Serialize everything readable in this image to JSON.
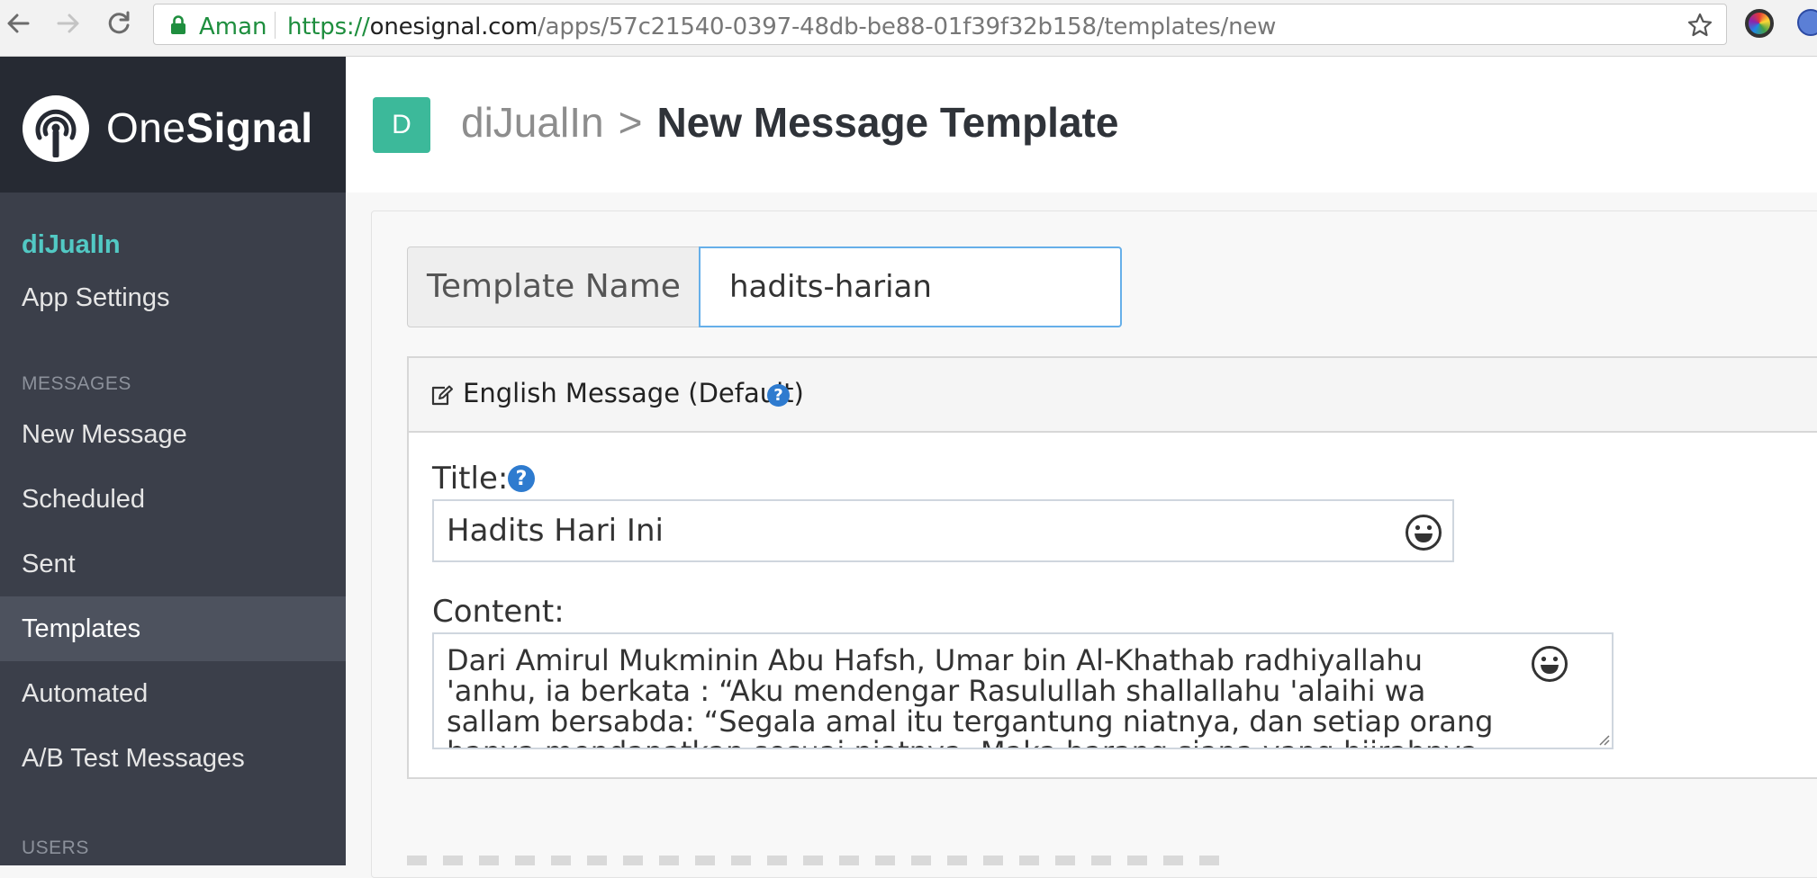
{
  "browser": {
    "secure_label": "Aman",
    "url_scheme": "https://",
    "url_host": "onesignal.com",
    "url_path": "/apps/57c21540-0397-48db-be88-01f39f32b158/templates/new",
    "icons": [
      "back-icon",
      "forward-icon",
      "reload-icon",
      "lock-icon",
      "star-icon"
    ]
  },
  "sidebar": {
    "brand_one": "One",
    "brand_signal": "Signal",
    "app_name": "diJualIn",
    "app_settings": "App Settings",
    "sections": {
      "messages": "MESSAGES",
      "users": "USERS"
    },
    "items": [
      {
        "label": "New Message"
      },
      {
        "label": "Scheduled"
      },
      {
        "label": "Sent"
      },
      {
        "label": "Templates",
        "active": true
      },
      {
        "label": "Automated"
      },
      {
        "label": "A/B Test Messages"
      }
    ]
  },
  "header": {
    "avatar_letter": "D",
    "app_name": "diJualIn",
    "separator": ">",
    "page_title": "New Message Template"
  },
  "form": {
    "template_name_label": "Template Name",
    "template_name_value": "hadits-harian",
    "message_heading": "English Message (Default)",
    "help_glyph": "?",
    "title_label": "Title:",
    "title_value": "Hadits Hari Ini",
    "content_label": "Content:",
    "content_value": "Dari Amirul Mukminin Abu Hafsh, Umar bin Al-Khathab radhiyallahu 'anhu, ia berkata : “Aku mendengar Rasulullah shallallahu 'alaihi wa sallam bersabda: “Segala amal itu tergantung niatnya, dan setiap orang hanya mendapatkan sesuai niatnya. Maka barang siapa yang hijrahnya kepada"
  },
  "colors": {
    "brand_teal": "#52c9c4",
    "avatar_green": "#3cb99a",
    "sidebar_bg": "#3b3f4a",
    "sidebar_header_bg": "#262a33",
    "focus_blue": "#66afe9",
    "help_blue": "#2e7bcf",
    "secure_green": "#1e8e3e"
  }
}
